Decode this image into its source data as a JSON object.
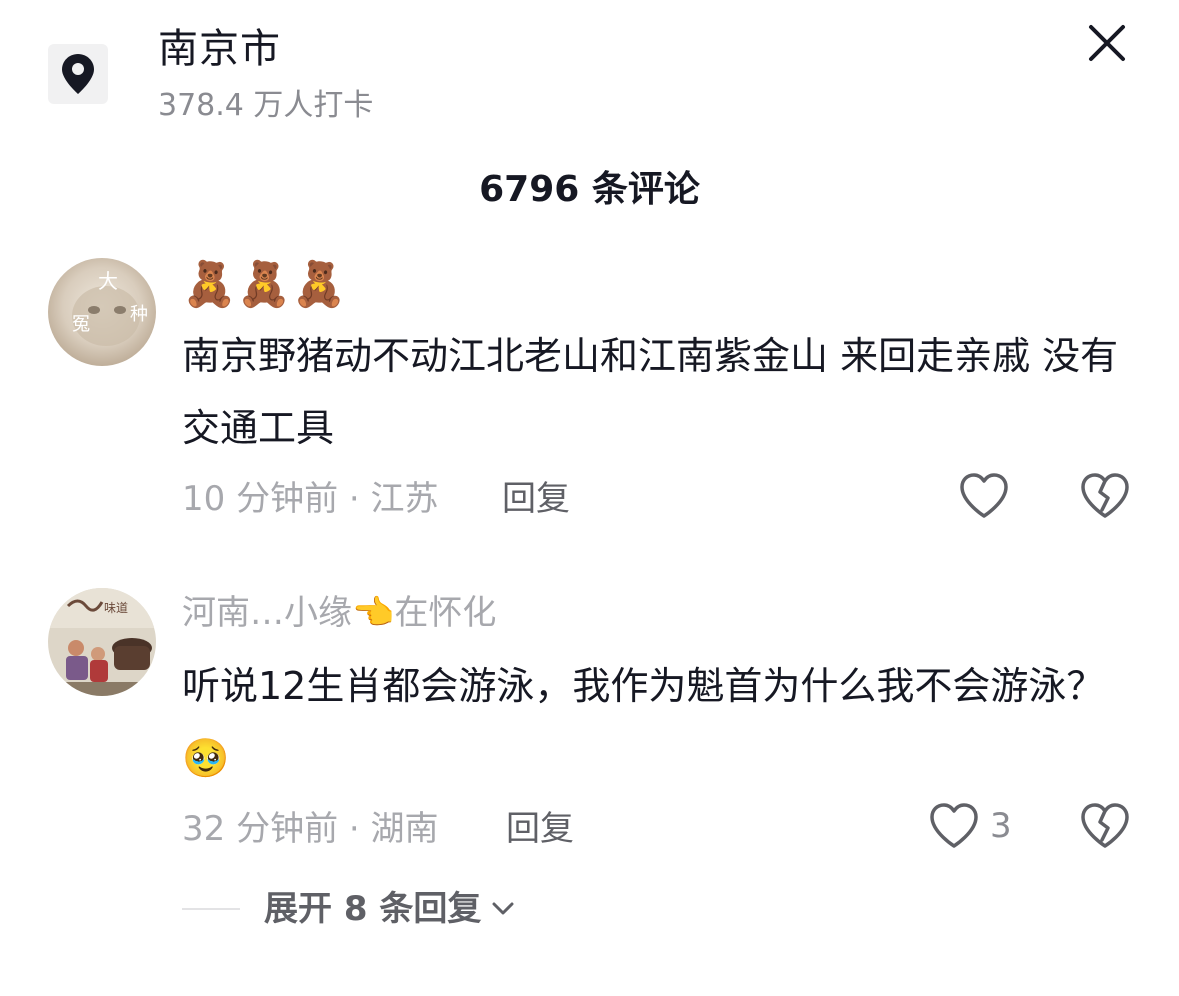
{
  "header": {
    "location_name": "南京市",
    "checkin_count": "378.4 万人打卡",
    "location_icon": "map-pin-icon",
    "close_icon": "close-icon"
  },
  "comments_title": "6796 条评论",
  "comments": [
    {
      "username": "",
      "emoji_name": "🧸🧸🧸",
      "avatar_text": [
        "大",
        "冤",
        "种"
      ],
      "text": "南京野猪动不动江北老山和江南紫金山 来回走亲戚 没有交通工具",
      "meta": "10 分钟前 · 江苏",
      "reply_label": "回复",
      "like_count": ""
    },
    {
      "username": "河南…小缘👈在怀化",
      "text": "听说12生肖都会游泳，我作为魁首为什么我不会游泳？🥹",
      "meta": "32 分钟前 · 湖南",
      "reply_label": "回复",
      "like_count": "3",
      "expand_label": "展开 8 条回复"
    }
  ],
  "colors": {
    "primary_text": "#161823",
    "secondary_text": "#a7a8ad",
    "action_text": "#5f6066",
    "icon_bg": "#f1f1f2"
  }
}
